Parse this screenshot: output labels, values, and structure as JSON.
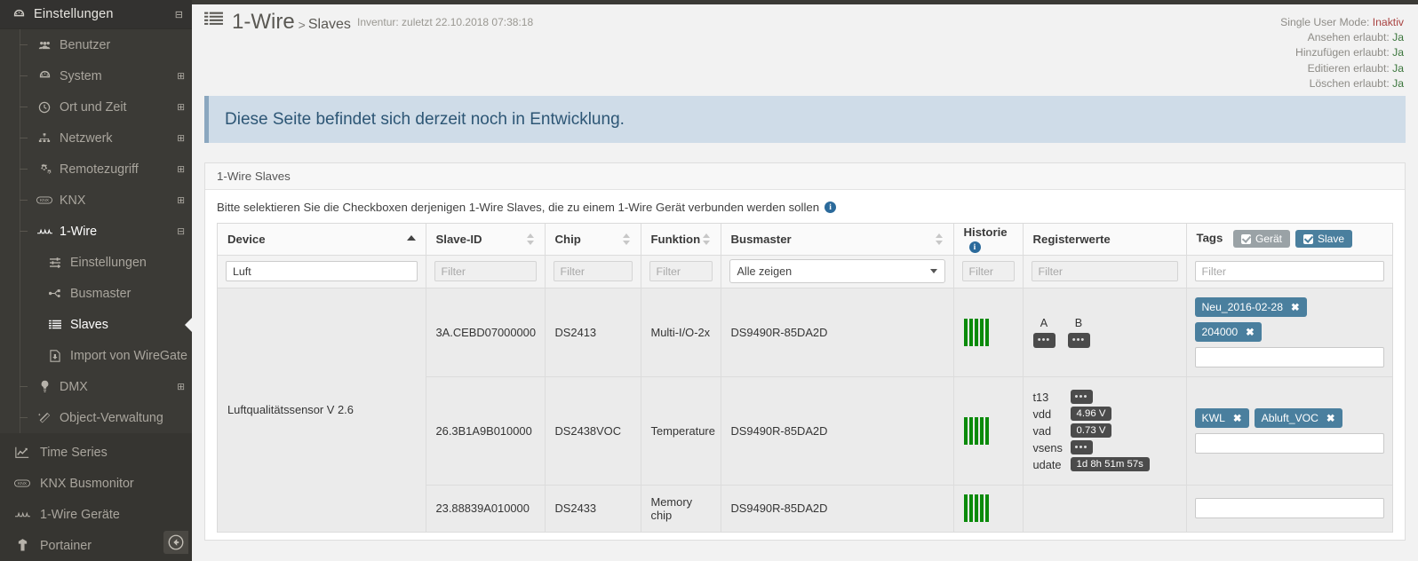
{
  "sidebar": {
    "header": {
      "title": "Einstellungen",
      "icon": "dashboard-icon",
      "toggle_icon": "collapse-minus-icon"
    },
    "items": [
      {
        "label": "Benutzer",
        "icon": "users-icon",
        "expander": "",
        "level": 1,
        "active": false
      },
      {
        "label": "System",
        "icon": "dashboard-icon",
        "expander": "⊞",
        "level": 1,
        "active": false
      },
      {
        "label": "Ort und Zeit",
        "icon": "clock-icon",
        "expander": "⊞",
        "level": 1,
        "active": false
      },
      {
        "label": "Netzwerk",
        "icon": "network-icon",
        "expander": "⊞",
        "level": 1,
        "active": false
      },
      {
        "label": "Remotezugriff",
        "icon": "gears-icon",
        "expander": "⊞",
        "level": 1,
        "active": false
      },
      {
        "label": "KNX",
        "icon": "knx-icon",
        "expander": "⊞",
        "level": 1,
        "active": false
      },
      {
        "label": "1-Wire",
        "icon": "onewire-icon",
        "expander": "⊟",
        "level": 1,
        "active": false
      },
      {
        "label": "Einstellungen",
        "icon": "sliders-icon",
        "expander": "",
        "level": 2,
        "active": false
      },
      {
        "label": "Busmaster",
        "icon": "usb-icon",
        "expander": "",
        "level": 2,
        "active": false
      },
      {
        "label": "Slaves",
        "icon": "list-icon",
        "expander": "",
        "level": 2,
        "active": true
      },
      {
        "label": "Import von WireGate",
        "icon": "file-import-icon",
        "expander": "",
        "level": 2,
        "active": false
      },
      {
        "label": "DMX",
        "icon": "bulb-icon",
        "expander": "⊞",
        "level": 1,
        "active": false
      },
      {
        "label": "Object-Verwaltung",
        "icon": "wand-icon",
        "expander": "",
        "level": 1,
        "active": false
      }
    ],
    "bottom_items": [
      {
        "label": "Time Series",
        "icon": "chart-line-icon"
      },
      {
        "label": "KNX Busmonitor",
        "icon": "knx-icon"
      },
      {
        "label": "1-Wire Geräte",
        "icon": "onewire-icon"
      },
      {
        "label": "Portainer",
        "icon": "portainer-icon"
      }
    ],
    "collapse_button": {
      "icon": "arrow-circle-left-icon"
    }
  },
  "header": {
    "icon": "list-icon",
    "title": "1-Wire",
    "separator": ">",
    "subtitle": "Slaves",
    "meta": "Inventur: zuletzt 22.10.2018 07:38:18"
  },
  "permissions": [
    {
      "label": "Single User Mode:",
      "value": "Inaktiv",
      "state": "no"
    },
    {
      "label": "Ansehen erlaubt:",
      "value": "Ja",
      "state": "yes"
    },
    {
      "label": "Hinzufügen erlaubt:",
      "value": "Ja",
      "state": "yes"
    },
    {
      "label": "Editieren erlaubt:",
      "value": "Ja",
      "state": "yes"
    },
    {
      "label": "Löschen erlaubt:",
      "value": "Ja",
      "state": "yes"
    }
  ],
  "alert": {
    "text": "Diese Seite befindet sich derzeit noch in Entwicklung."
  },
  "panel": {
    "title": "1-Wire Slaves",
    "note": "Bitte selektieren Sie die Checkboxen derjenigen 1-Wire Slaves, die zu einem 1-Wire Gerät verbunden werden sollen",
    "note_info_icon": "info-icon"
  },
  "table": {
    "columns": [
      {
        "key": "device",
        "label": "Device",
        "sort": "asc"
      },
      {
        "key": "slaveid",
        "label": "Slave-ID",
        "sort": "none"
      },
      {
        "key": "chip",
        "label": "Chip",
        "sort": "none"
      },
      {
        "key": "funktion",
        "label": "Funktion",
        "sort": "none"
      },
      {
        "key": "busmaster",
        "label": "Busmaster",
        "sort": "none"
      },
      {
        "key": "historie",
        "label": "Historie",
        "sort": null,
        "info_icon": "info-icon"
      },
      {
        "key": "register",
        "label": "Registerwerte",
        "sort": null
      },
      {
        "key": "tags",
        "label": "Tags",
        "sort": null
      }
    ],
    "tag_toggles": [
      {
        "label": "Gerät",
        "checked": true,
        "active": false
      },
      {
        "label": "Slave",
        "checked": true,
        "active": true
      }
    ],
    "filters": {
      "device": {
        "value": "Luft",
        "placeholder": "Filter"
      },
      "slaveid": {
        "value": "",
        "placeholder": "Filter"
      },
      "chip": {
        "value": "",
        "placeholder": "Filter"
      },
      "funktion": {
        "value": "",
        "placeholder": "Filter"
      },
      "busmaster": {
        "value": "Alle zeigen",
        "placeholder": "Alle zeigen"
      },
      "historie": {
        "value": "",
        "placeholder": "Filter"
      },
      "register": {
        "value": "",
        "placeholder": "Filter"
      },
      "tags": {
        "value": "",
        "placeholder": "Filter"
      }
    },
    "device_group_label": "Luftqualitätssensor V 2.6",
    "rows": [
      {
        "slaveid": "3A.CEBD07000000",
        "chip": "DS2413",
        "funktion": "Multi-I/O-2x",
        "busmaster": "DS9490R-85DA2D",
        "historie_bars": 5,
        "register_type": "ab",
        "register_ab": [
          {
            "label": "A",
            "value": "•••"
          },
          {
            "label": "B",
            "value": "•••"
          }
        ],
        "register_rows": [],
        "tags": [
          "Neu_2016-02-28",
          "204000"
        ]
      },
      {
        "slaveid": "26.3B1A9B010000",
        "chip": "DS2438VOC",
        "funktion": "Temperature",
        "busmaster": "DS9490R-85DA2D",
        "historie_bars": 5,
        "register_type": "list",
        "register_ab": [],
        "register_rows": [
          {
            "key": "t13",
            "value": "•••",
            "dots": true
          },
          {
            "key": "vdd",
            "value": "4.96 V",
            "dots": false
          },
          {
            "key": "vad",
            "value": "0.73 V",
            "dots": false
          },
          {
            "key": "vsens",
            "value": "•••",
            "dots": true
          },
          {
            "key": "udate",
            "value": "1d 8h 51m 57s",
            "dots": false
          }
        ],
        "tags": [
          "KWL",
          "Abluft_VOC"
        ]
      },
      {
        "slaveid": "23.88839A010000",
        "chip": "DS2433",
        "funktion": "Memory chip",
        "busmaster": "DS9490R-85DA2D",
        "historie_bars": 5,
        "register_type": "none",
        "register_ab": [],
        "register_rows": [],
        "tags": []
      }
    ]
  },
  "colors": {
    "accent": "#4a7f9e",
    "sidebar_bg": "#3b3a36",
    "alert_bg": "#cfdce8",
    "alert_text": "#2d5675",
    "bar_green": "#0a8a0a",
    "yes": "#3c763d",
    "no": "#a94442"
  }
}
